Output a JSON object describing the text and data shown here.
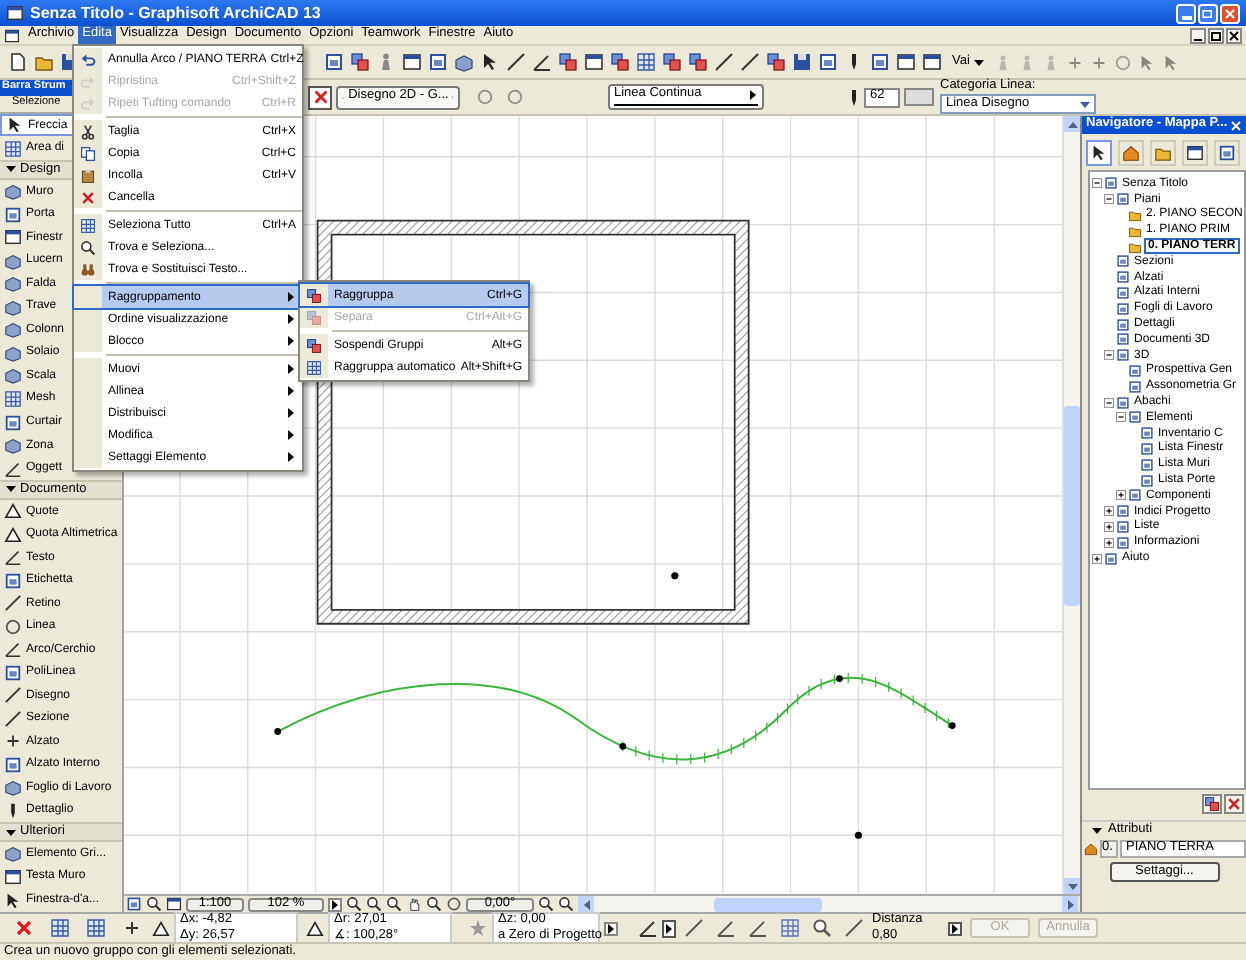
{
  "window": {
    "title": "Senza Titolo - Graphisoft ArchiCAD 13"
  },
  "menu_bar": [
    {
      "label": "Archivio",
      "selected": false
    },
    {
      "label": "Edita",
      "selected": true
    },
    {
      "label": "Visualizza",
      "selected": false
    },
    {
      "label": "Design",
      "selected": false
    },
    {
      "label": "Documento",
      "selected": false
    },
    {
      "label": "Opzioni",
      "selected": false
    },
    {
      "label": "Teamwork",
      "selected": false
    },
    {
      "label": "Finestre",
      "selected": false
    },
    {
      "label": "Aiuto",
      "selected": false
    }
  ],
  "toolbar": {
    "go_to": "Vai"
  },
  "info_box": {
    "layer": "Disegno 2D - G...",
    "line_type": "Linea Continua",
    "pen": "62",
    "category_label": "Categoria Linea:",
    "category": "Linea Disegno"
  },
  "toolbox": {
    "title": "Barra Strum",
    "selection_label": "Selezione",
    "items": [
      {
        "kind": "tool",
        "label": "Freccia",
        "selected": true
      },
      {
        "kind": "tool",
        "label": "Area di",
        "selected": false
      },
      {
        "kind": "section",
        "label": "Design",
        "expanded": true
      },
      {
        "kind": "tool",
        "label": "Muro",
        "selected": false
      },
      {
        "kind": "tool",
        "label": "Porta",
        "selected": false
      },
      {
        "kind": "tool",
        "label": "Finestr",
        "selected": false
      },
      {
        "kind": "tool",
        "label": "Lucern",
        "selected": false
      },
      {
        "kind": "tool",
        "label": "Falda",
        "selected": false
      },
      {
        "kind": "tool",
        "label": "Trave",
        "selected": false
      },
      {
        "kind": "tool",
        "label": "Colonn",
        "selected": false
      },
      {
        "kind": "tool",
        "label": "Solaio",
        "selected": false
      },
      {
        "kind": "tool",
        "label": "Scala",
        "selected": false
      },
      {
        "kind": "tool",
        "label": "Mesh",
        "selected": false
      },
      {
        "kind": "tool",
        "label": "Curtair",
        "selected": false
      },
      {
        "kind": "tool",
        "label": "Zona",
        "selected": false
      },
      {
        "kind": "tool",
        "label": "Oggett",
        "selected": false
      },
      {
        "kind": "section",
        "label": "Documento",
        "expanded": true
      },
      {
        "kind": "tool",
        "label": "Quote",
        "selected": false
      },
      {
        "kind": "tool",
        "label": "Quota Altimetrica",
        "selected": false
      },
      {
        "kind": "tool",
        "label": "Testo",
        "selected": false
      },
      {
        "kind": "tool",
        "label": "Etichetta",
        "selected": false
      },
      {
        "kind": "tool",
        "label": "Retino",
        "selected": false
      },
      {
        "kind": "tool",
        "label": "Linea",
        "selected": false
      },
      {
        "kind": "tool",
        "label": "Arco/Cerchio",
        "selected": false
      },
      {
        "kind": "tool",
        "label": "PoliLinea",
        "selected": false
      },
      {
        "kind": "tool",
        "label": "Disegno",
        "selected": false
      },
      {
        "kind": "tool",
        "label": "Sezione",
        "selected": false
      },
      {
        "kind": "tool",
        "label": "Alzato",
        "selected": false
      },
      {
        "kind": "tool",
        "label": "Alzato Interno",
        "selected": false
      },
      {
        "kind": "tool",
        "label": "Foglio di Lavoro",
        "selected": false
      },
      {
        "kind": "tool",
        "label": "Dettaglio",
        "selected": false
      },
      {
        "kind": "section",
        "label": "Ulteriori",
        "expanded": true
      },
      {
        "kind": "tool",
        "label": "Elemento Gri...",
        "selected": false
      },
      {
        "kind": "tool",
        "label": "Testa Muro",
        "selected": false
      },
      {
        "kind": "tool",
        "label": "Finestra-d'a...",
        "selected": false
      }
    ]
  },
  "edit_menu": [
    {
      "kind": "item",
      "label": "Annulla Arco / PIANO TERRA",
      "shortcut": "Ctrl+Z",
      "disabled": false,
      "selected": false
    },
    {
      "kind": "item",
      "label": "Ripristina",
      "shortcut": "Ctrl+Shift+Z",
      "disabled": true,
      "selected": false
    },
    {
      "kind": "item",
      "label": "Ripeti Tufting comando",
      "shortcut": "Ctrl+R",
      "disabled": true,
      "selected": false
    },
    {
      "kind": "separator"
    },
    {
      "kind": "item",
      "label": "Taglia",
      "shortcut": "Ctrl+X",
      "disabled": false,
      "selected": false
    },
    {
      "kind": "item",
      "label": "Copia",
      "shortcut": "Ctrl+C",
      "disabled": false,
      "selected": false
    },
    {
      "kind": "item",
      "label": "Incolla",
      "shortcut": "Ctrl+V",
      "disabled": false,
      "selected": false
    },
    {
      "kind": "item",
      "label": "Cancella",
      "disabled": false,
      "selected": false
    },
    {
      "kind": "separator"
    },
    {
      "kind": "item",
      "label": "Seleziona Tutto",
      "shortcut": "Ctrl+A",
      "disabled": false,
      "selected": false
    },
    {
      "kind": "item",
      "label": "Trova e Seleziona...",
      "disabled": false,
      "selected": false
    },
    {
      "kind": "item",
      "label": "Trova e Sostituisci Testo...",
      "disabled": false,
      "selected": false
    },
    {
      "kind": "separator"
    },
    {
      "kind": "submenu",
      "label": "Raggruppamento",
      "disabled": false,
      "selected": true
    },
    {
      "kind": "submenu",
      "label": "Ordine visualizzazione",
      "disabled": false,
      "selected": false
    },
    {
      "kind": "submenu",
      "label": "Blocco",
      "disabled": false,
      "selected": false
    },
    {
      "kind": "separator"
    },
    {
      "kind": "submenu",
      "label": "Muovi",
      "disabled": false,
      "selected": false
    },
    {
      "kind": "submenu",
      "label": "Allinea",
      "disabled": false,
      "selected": false
    },
    {
      "kind": "submenu",
      "label": "Distribuisci",
      "disabled": false,
      "selected": false
    },
    {
      "kind": "submenu",
      "label": "Modifica",
      "disabled": false,
      "selected": false
    },
    {
      "kind": "submenu",
      "label": "Settaggi Elemento",
      "disabled": false,
      "selected": false
    }
  ],
  "group_submenu": [
    {
      "kind": "item",
      "label": "Raggruppa",
      "shortcut": "Ctrl+G",
      "disabled": false,
      "selected": true
    },
    {
      "kind": "item",
      "label": "Separa",
      "shortcut": "Ctrl+Alt+G",
      "disabled": true,
      "selected": false
    },
    {
      "kind": "separator"
    },
    {
      "kind": "item",
      "label": "Sospendi Gruppi",
      "shortcut": "Alt+G",
      "disabled": false,
      "selected": false
    },
    {
      "kind": "item",
      "label": "Raggruppa automatico",
      "shortcut": "Alt+Shift+G",
      "disabled": false,
      "selected": false
    }
  ],
  "view_bar": {
    "scale": "1:100",
    "zoom": "102 %",
    "angle": "0,00°"
  },
  "navigator": {
    "title": "Navigatore - Mappa P...",
    "tree": [
      {
        "label": "Senza Titolo",
        "expanded": true,
        "selected": false,
        "children": [
          {
            "label": "Piani",
            "expanded": true,
            "selected": false,
            "children": [
              {
                "label": "2. PIANO SECON",
                "selected": false
              },
              {
                "label": "1. PIANO PRIM",
                "selected": false
              },
              {
                "label": "0. PIANO TERR",
                "selected": true
              }
            ]
          },
          {
            "label": "Sezioni",
            "selected": false
          },
          {
            "label": "Alzati",
            "selected": false
          },
          {
            "label": "Alzati Interni",
            "selected": false
          },
          {
            "label": "Fogli di Lavoro",
            "selected": false
          },
          {
            "label": "Dettagli",
            "selected": false
          },
          {
            "label": "Documenti 3D",
            "selected": false
          },
          {
            "label": "3D",
            "expanded": true,
            "selected": false,
            "children": [
              {
                "label": "Prospettiva Gen",
                "selected": false
              },
              {
                "label": "Assonometria Gr",
                "selected": false
              }
            ]
          },
          {
            "label": "Abachi",
            "expanded": true,
            "selected": false,
            "children": [
              {
                "label": "Elementi",
                "expanded": true,
                "selected": false,
                "children": [
                  {
                    "label": "Inventario C",
                    "selected": false
                  },
                  {
                    "label": "Lista Finestr",
                    "selected": false
                  },
                  {
                    "label": "Lista Muri",
                    "selected": false
                  },
                  {
                    "label": "Lista Porte",
                    "selected": false
                  }
                ]
              },
              {
                "label": "Componenti",
                "expanded": false,
                "selected": false
              }
            ]
          },
          {
            "label": "Indici Progetto",
            "expanded": false,
            "selected": false
          },
          {
            "label": "Liste",
            "expanded": false,
            "selected": false
          },
          {
            "label": "Informazioni",
            "expanded": false,
            "selected": false
          }
        ]
      },
      {
        "label": "Aiuto",
        "expanded": false,
        "selected": false
      }
    ],
    "attributes": {
      "title": "Attributi",
      "floor_number": "0.",
      "floor_name": "PIANO TERRA",
      "button": "Settaggi..."
    }
  },
  "coordinates": {
    "x": "Δx: -4,82",
    "y": "Δy: 26,57",
    "r": "Δr: 27,01",
    "angle": "∡: 100,28°",
    "z": "Δz: 0,00",
    "z_ref": "a Zero di Progetto",
    "distance_label": "Distanza",
    "distance": "0,80"
  },
  "dialog_buttons": [
    {
      "label": "OK",
      "disabled": true
    },
    {
      "label": "Annulla",
      "disabled": true
    }
  ],
  "status_bar": {
    "text": "Crea un nuovo gruppo con gli elementi selezionati."
  }
}
